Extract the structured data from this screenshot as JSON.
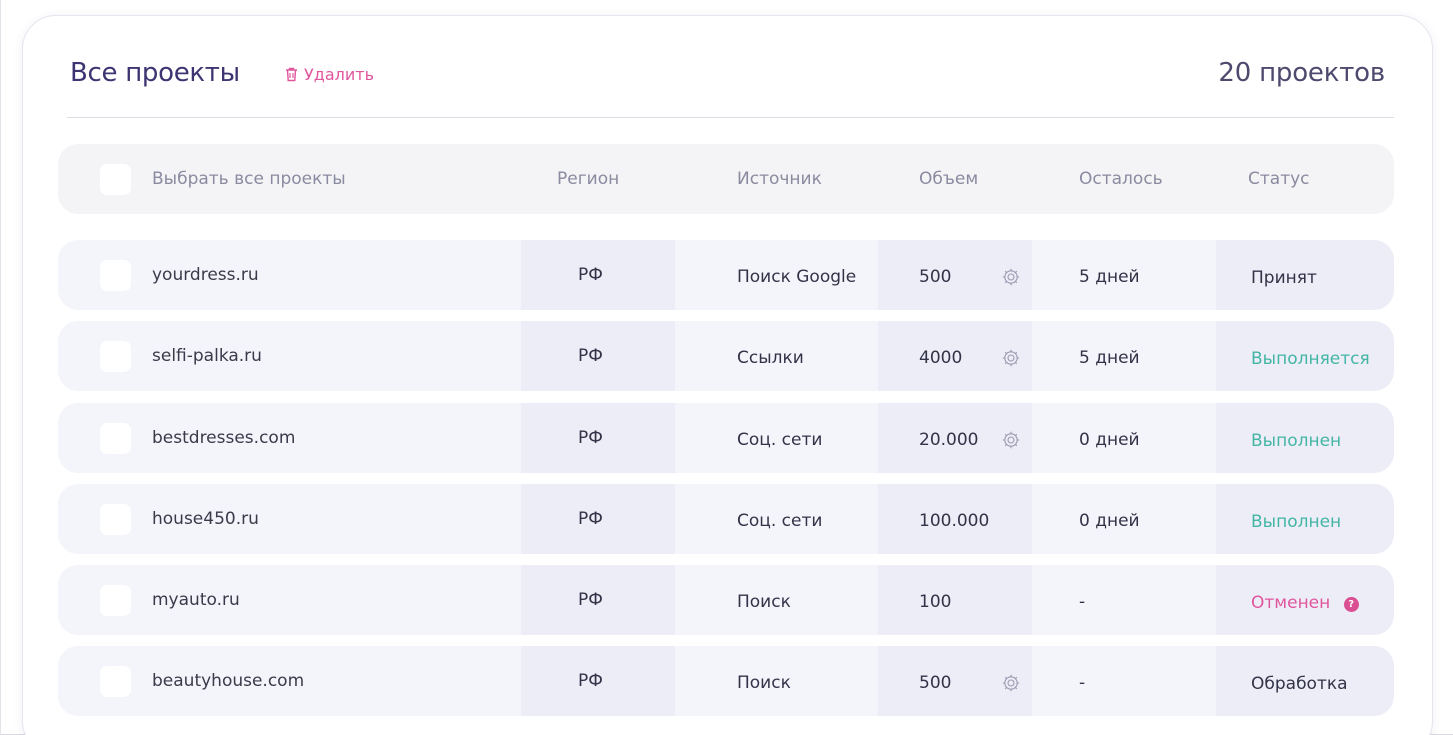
{
  "header": {
    "title": "Все проекты",
    "delete_label": "Удалить",
    "count_label": "20 проектов"
  },
  "table": {
    "columns": {
      "select_all": "Выбрать все проекты",
      "region": "Регион",
      "source": "Источник",
      "volume": "Объем",
      "remaining": "Осталось",
      "status": "Статус"
    },
    "rows": [
      {
        "name": "yourdress.ru",
        "region": "РФ",
        "source": "Поиск Google",
        "volume": "500",
        "remaining": "5 дней",
        "status": "Принят",
        "status_color": "#333348",
        "has_settings": true,
        "has_help": false
      },
      {
        "name": "selfi-palka.ru",
        "region": "РФ",
        "source": "Ссылки",
        "volume": "4000",
        "remaining": "5 дней",
        "status": "Выполняется",
        "status_color": "#43b5a5",
        "has_settings": true,
        "has_help": false
      },
      {
        "name": "bestdresses.com",
        "region": "РФ",
        "source": "Соц. сети",
        "volume": "20.000",
        "remaining": "0 дней",
        "status": "Выполнен",
        "status_color": "#43b5a5",
        "has_settings": true,
        "has_help": false
      },
      {
        "name": "house450.ru",
        "region": "РФ",
        "source": "Соц. сети",
        "volume": "100.000",
        "remaining": "0 дней",
        "status": "Выполнен",
        "status_color": "#43b5a5",
        "has_settings": false,
        "has_help": false
      },
      {
        "name": "myauto.ru",
        "region": "РФ",
        "source": "Поиск",
        "volume": "100",
        "remaining": "-",
        "status": "Отменен",
        "status_color": "#e0569d",
        "has_settings": false,
        "has_help": true
      },
      {
        "name": "beautyhouse.com",
        "region": "РФ",
        "source": "Поиск",
        "volume": "500",
        "remaining": "-",
        "status": "Обработка",
        "status_color": "#333348",
        "has_settings": true,
        "has_help": false
      }
    ]
  },
  "icons": {
    "delete": "trash-icon",
    "settings": "gear-icon",
    "help": "question-icon"
  },
  "colors": {
    "title": "#3c3572",
    "delete": "#e0569d",
    "status_success": "#43b5a5",
    "status_cancelled": "#e0569d"
  }
}
